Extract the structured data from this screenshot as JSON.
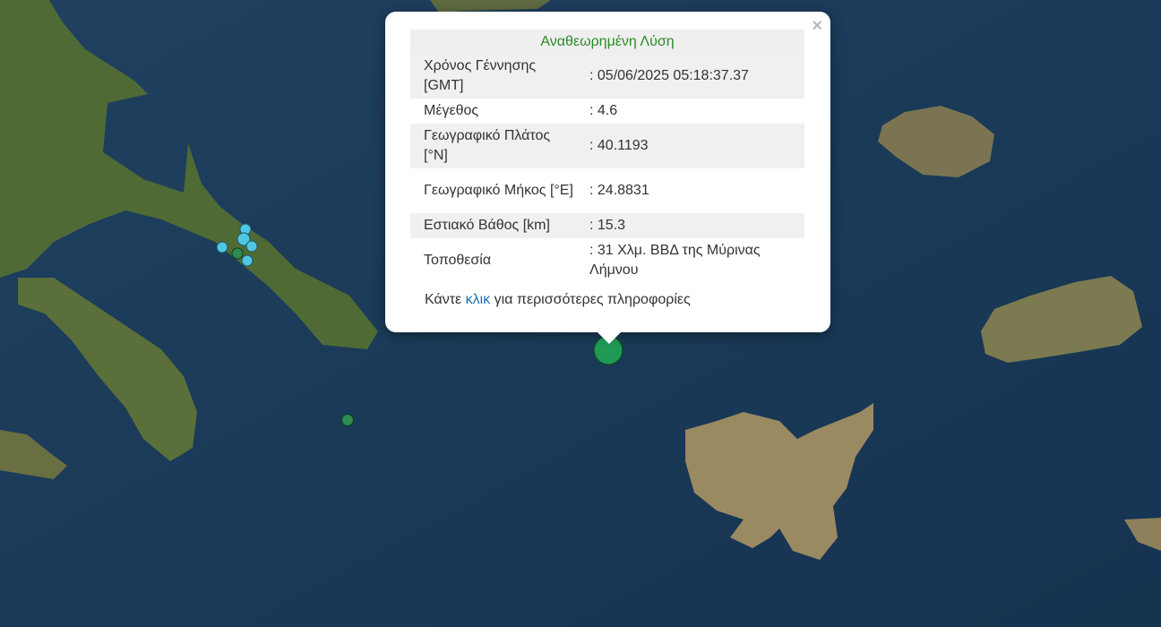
{
  "popup": {
    "title": "Αναθεωρημένη Λύση",
    "close_label": "×",
    "rows": [
      {
        "label": "Χρόνος Γέννησης [GMT]",
        "value": ": 05/06/2025 05:18:37.37"
      },
      {
        "label": "Μέγεθος",
        "value": ": 4.6"
      },
      {
        "label": "Γεωγραφικό Πλάτος [°N]",
        "value": ": 40.1193"
      },
      {
        "label": "Γεωγραφικό Μήκος [°E]",
        "value": ": 24.8831"
      },
      {
        "label": "Εστιακό Βάθος [km]",
        "value": ": 15.3"
      },
      {
        "label": "Τοποθεσία",
        "value": ": 31 Χλμ. ΒΒΔ της Μύρινας Λήμνου"
      }
    ],
    "more_prefix": "Κάντε",
    "more_link": "κλικ",
    "more_suffix": "για περισσότερες πληροφορίες"
  },
  "colors": {
    "sea": "#1d3b5c",
    "land": "#5c6b3c",
    "main_event": "#1f9a55",
    "recent_event": "#4fc7e0",
    "older_event": "#2e8b4f"
  }
}
